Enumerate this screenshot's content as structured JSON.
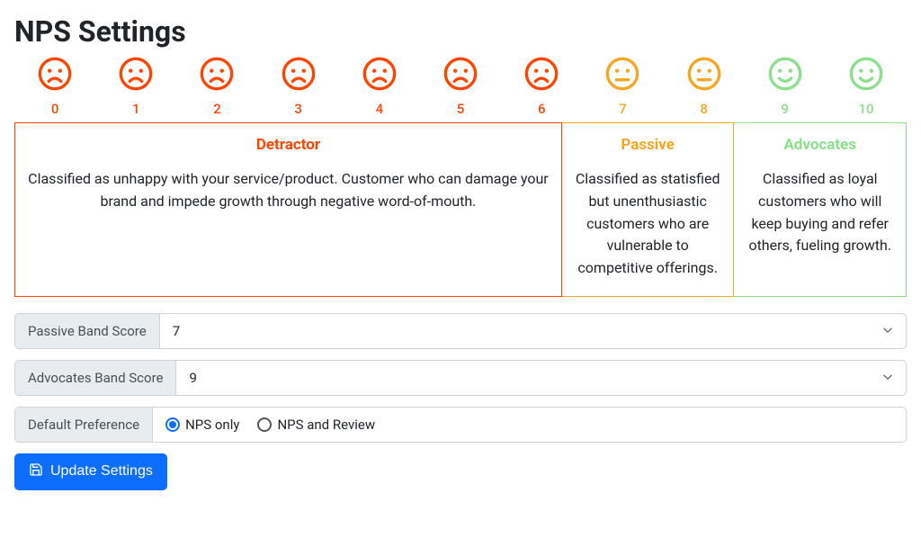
{
  "title": "NPS Settings",
  "faces": [
    {
      "num": "0",
      "mood": "frown",
      "cls": "detractor-color"
    },
    {
      "num": "1",
      "mood": "frown",
      "cls": "detractor-color"
    },
    {
      "num": "2",
      "mood": "frown",
      "cls": "detractor-color"
    },
    {
      "num": "3",
      "mood": "frown",
      "cls": "detractor-color"
    },
    {
      "num": "4",
      "mood": "frown",
      "cls": "detractor-color"
    },
    {
      "num": "5",
      "mood": "frown",
      "cls": "detractor-color"
    },
    {
      "num": "6",
      "mood": "frown",
      "cls": "detractor-color"
    },
    {
      "num": "7",
      "mood": "neutral",
      "cls": "passive-color"
    },
    {
      "num": "8",
      "mood": "neutral",
      "cls": "passive-color"
    },
    {
      "num": "9",
      "mood": "smile",
      "cls": "advocates-color"
    },
    {
      "num": "10",
      "mood": "smile",
      "cls": "advocates-color"
    }
  ],
  "categories": {
    "detractor": {
      "title": "Detractor",
      "desc": "Classified as unhappy with your service/product. Customer who can damage your brand and impede growth through negative word-of-mouth."
    },
    "passive": {
      "title": "Passive",
      "desc": "Classified as statisfied but unenthusiastic customers who are vulnerable to competitive offerings."
    },
    "advocates": {
      "title": "Advocates",
      "desc": "Classified as loyal customers who will keep buying and refer others, fueling growth."
    }
  },
  "form": {
    "passive_label": "Passive Band Score",
    "passive_value": "7",
    "advocates_label": "Advocates Band Score",
    "advocates_value": "9",
    "preference_label": "Default Preference",
    "radio1": "NPS only",
    "radio2": "NPS and Review",
    "radio_selected": "radio1"
  },
  "button": {
    "label": "Update Settings"
  }
}
